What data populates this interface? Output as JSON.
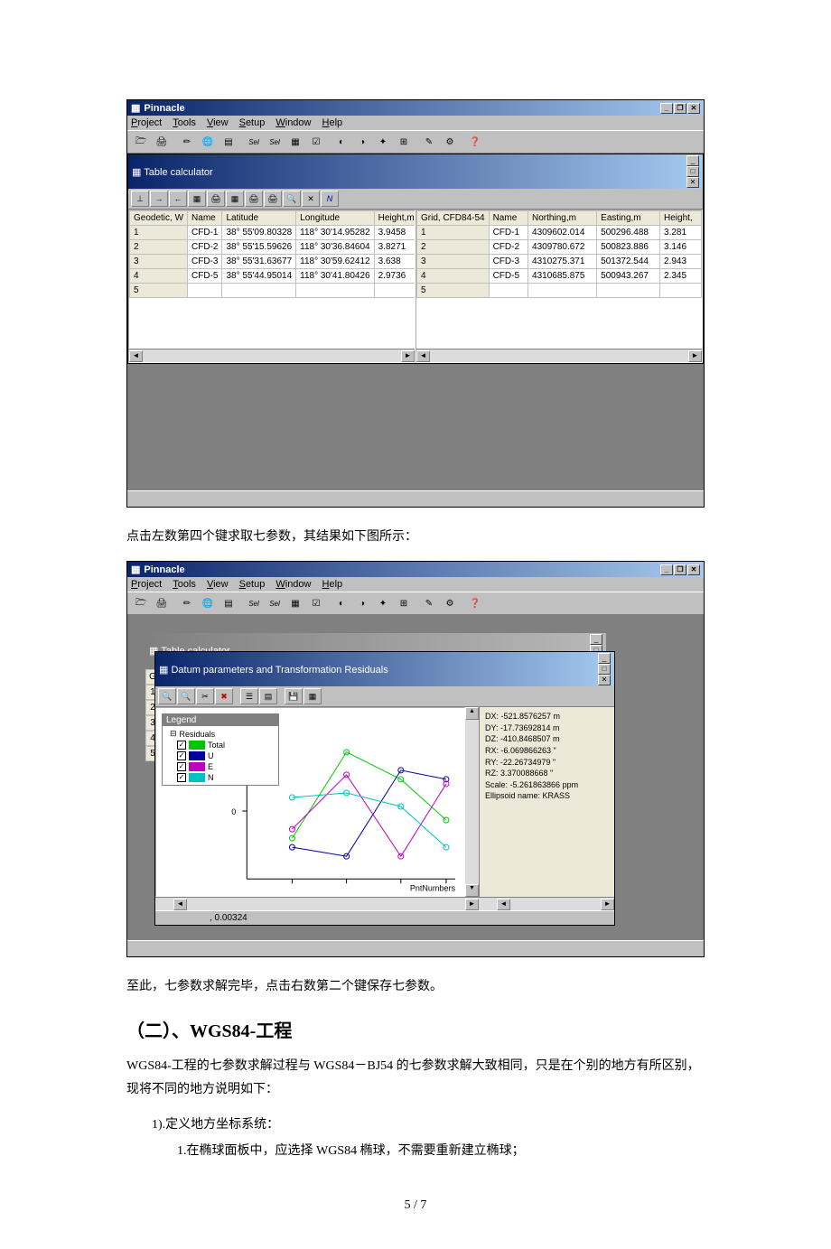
{
  "app_title": "Pinnacle",
  "menu": [
    "Project",
    "Tools",
    "View",
    "Setup",
    "Window",
    "Help"
  ],
  "child1_title": "Table calculator",
  "left_table": {
    "headers": [
      "Geodetic, W",
      "Name",
      "Latitude",
      "Longitude",
      "Height,m"
    ],
    "rows": [
      {
        "n": "1",
        "name": "CFD-1",
        "lat": "38° 55'09.80328",
        "lon": "118° 30'14.95282",
        "h": "3.9458"
      },
      {
        "n": "2",
        "name": "CFD-2",
        "lat": "38° 55'15.59626",
        "lon": "118° 30'36.84604",
        "h": "3.8271"
      },
      {
        "n": "3",
        "name": "CFD-3",
        "lat": "38° 55'31.63677",
        "lon": "118° 30'59.62412",
        "h": "3.638"
      },
      {
        "n": "4",
        "name": "CFD-5",
        "lat": "38° 55'44.95014",
        "lon": "118° 30'41.80426",
        "h": "2.9736"
      },
      {
        "n": "5",
        "name": "",
        "lat": "",
        "lon": "",
        "h": ""
      }
    ]
  },
  "right_table": {
    "headers": [
      "Grid, CFD84-54",
      "Name",
      "Northing,m",
      "Easting,m",
      "Height,"
    ],
    "rows": [
      {
        "n": "1",
        "name": "CFD-1",
        "nor": "4309602.014",
        "eas": "500296.488",
        "h": "3.281"
      },
      {
        "n": "2",
        "name": "CFD-2",
        "nor": "4309780.672",
        "eas": "500823.886",
        "h": "3.146"
      },
      {
        "n": "3",
        "name": "CFD-3",
        "nor": "4310275.371",
        "eas": "501372.544",
        "h": "2.943"
      },
      {
        "n": "4",
        "name": "CFD-5",
        "nor": "4310685.875",
        "eas": "500943.267",
        "h": "2.345"
      },
      {
        "n": "5",
        "name": "",
        "nor": "",
        "eas": "",
        "h": ""
      }
    ]
  },
  "text1": "点击左数第四个键求取七参数，其结果如下图所示：",
  "app2_title": "Pinnacle",
  "child2a_title": "Table calculator",
  "child2b_title": "Datum parameters and Transformation Residuals",
  "legend_title": "Legend",
  "legend_root": "Residuals",
  "legend_items": [
    {
      "label": "Total",
      "color": "#00c800"
    },
    {
      "label": "U",
      "color": "#0000a0"
    },
    {
      "label": "E",
      "color": "#c000c0"
    },
    {
      "label": "N",
      "color": "#00c0c0"
    }
  ],
  "datum_params": [
    "DX: -521.8576257 m",
    "DY: -17.73692814 m",
    "DZ: -410.8468507 m",
    "RX: -6.069866263 \"",
    "RY: -22.26734979 \"",
    "RZ: 3.370088668 \"",
    "Scale: -5.261863866 ppm",
    "Ellipsoid name: KRASS"
  ],
  "chart_xlabel": "PntNumbers",
  "chart_ytick": "0",
  "status_value": ", 0.00324",
  "stub_header": "G",
  "stubs": [
    "1",
    "2",
    "3",
    "4",
    "5"
  ],
  "text2": "至此，七参数求解完毕，点击右数第二个键保存七参数。",
  "h2": "（二）、WGS84-工程",
  "text3": "WGS84-工程的七参数求解过程与 WGS84－BJ54 的七参数求解大致相同，只是在个别的地方有所区别，现将不同的地方说明如下：",
  "text4": "1).定义地方坐标系统：",
  "text5": "1.在椭球面板中，应选择 WGS84 椭球，不需要重新建立椭球；",
  "pagenum": "5 / 7",
  "chart_data": {
    "type": "line",
    "xlabel": "PntNumbers",
    "x": [
      1,
      2,
      3,
      4
    ],
    "ylim": [
      -0.007,
      0.007
    ],
    "yticks": [
      0
    ],
    "legend_position": "upper-left",
    "series": [
      {
        "name": "Total",
        "color": "#00c800",
        "values": [
          -0.003,
          0.0065,
          0.0035,
          -0.001
        ]
      },
      {
        "name": "U",
        "color": "#0000a0",
        "values": [
          -0.004,
          -0.005,
          0.0045,
          0.0035
        ]
      },
      {
        "name": "E",
        "color": "#c000c0",
        "values": [
          -0.002,
          0.004,
          -0.005,
          0.003
        ]
      },
      {
        "name": "N",
        "color": "#00c0c0",
        "values": [
          0.0015,
          0.002,
          0.0005,
          -0.004
        ]
      }
    ]
  }
}
